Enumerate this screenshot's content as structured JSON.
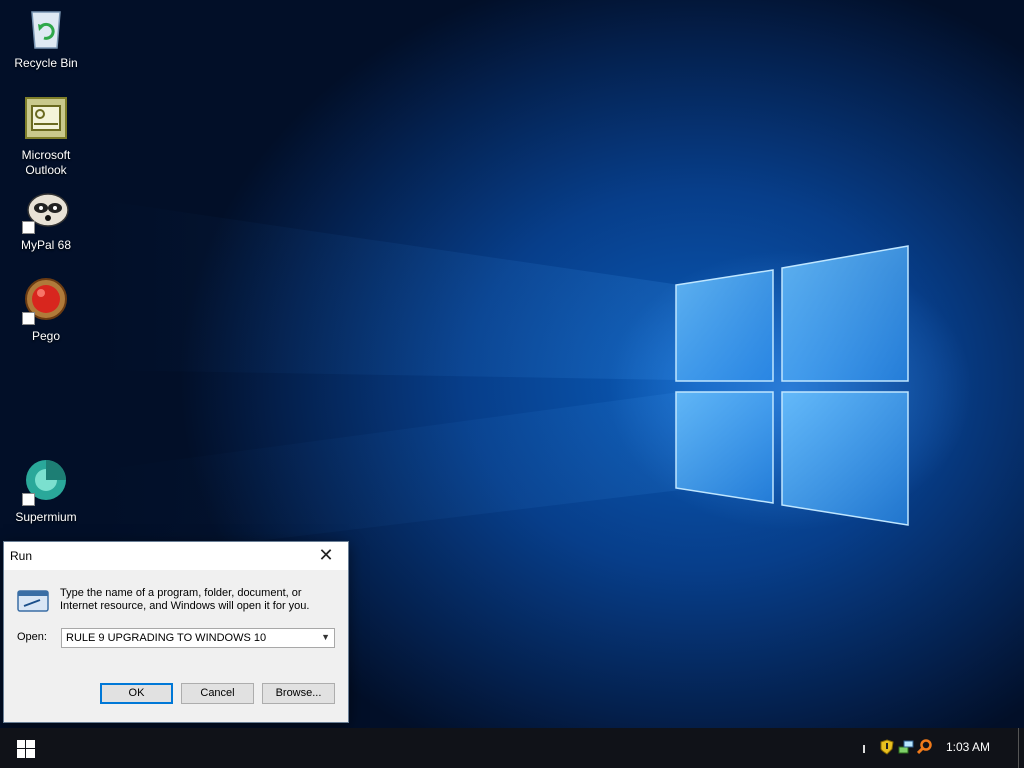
{
  "desktop": {
    "icons": [
      {
        "label": "Recycle Bin",
        "icon": "recycle-bin-icon"
      },
      {
        "label_line1": "Microsoft",
        "label_line2": "Outlook",
        "icon": "outlook-icon"
      },
      {
        "label": "MyPal 68",
        "icon": "mypal-icon"
      },
      {
        "label": "Pego",
        "icon": "pego-icon"
      },
      {
        "label": "Supermium",
        "icon": "supermium-icon"
      }
    ]
  },
  "run_dialog": {
    "title": "Run",
    "description_line1": "Type the name of a program, folder, document, or",
    "description_line2": "Internet resource, and Windows will open it for you.",
    "open_label": "Open:",
    "open_value": "RULE 9 UPGRADING TO WINDOWS 10",
    "ok_label": "OK",
    "cancel_label": "Cancel",
    "browse_label": "Browse..."
  },
  "taskbar": {
    "clock": "1:03 AM",
    "tray_icons": [
      "security-shield-icon",
      "network-icon",
      "search-magnifier-icon"
    ]
  },
  "colors": {
    "accent": "#0078d7",
    "taskbar": "#101218",
    "dialog_bg": "#f0f0f0"
  }
}
